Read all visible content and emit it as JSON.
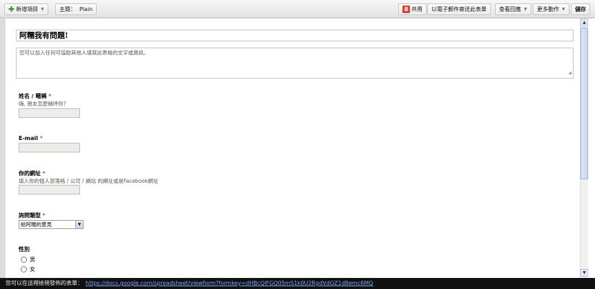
{
  "toolbar": {
    "new_item_label": "新增項目",
    "theme_label": "主題：",
    "theme_value": "Plain",
    "share_label": "共用",
    "email_form_label": "以電子郵件寄送此表單",
    "view_responses_label": "查看回應",
    "more_actions_label": "更多動作",
    "save_label": "儲存",
    "icons": {
      "new_item": "plus-icon",
      "share": "google-icon",
      "dropdown": "chevron-down-icon"
    }
  },
  "form": {
    "title": "阿糯我有問題!",
    "description": "您可以加入任何可協助其他人填寫此表格的文字或資訊。"
  },
  "questions": [
    {
      "label": "姓名 / 暱稱",
      "required": "*",
      "help": "嗨, 朋友怎麼稱呼你?",
      "type": "text"
    },
    {
      "label": "E-mail",
      "required": "*",
      "help": "",
      "type": "text"
    },
    {
      "label": "你的網址",
      "required": "*",
      "help": "填入你的個人部落格 / 公司 / 網站 的網址或是Facebook網址",
      "type": "text"
    },
    {
      "label": "詢問類型",
      "required": "*",
      "help": "",
      "type": "select",
      "selected": "給阿糯的意見"
    },
    {
      "label": "性別",
      "required": "",
      "help": "",
      "type": "radio",
      "options": [
        "男",
        "女"
      ]
    }
  ],
  "statusbar": {
    "text": "您可以在這裡檢視發佈的表單：",
    "link": "https://docs.google.com/spreadsheet/viewform?formkey=dHBcQlFGQ05mS1k0U2RgdVdOZ1dBemc6MQ"
  },
  "colors": {
    "accent": "#d94131",
    "link": "#7fa8ff",
    "required": "#cc0000"
  }
}
